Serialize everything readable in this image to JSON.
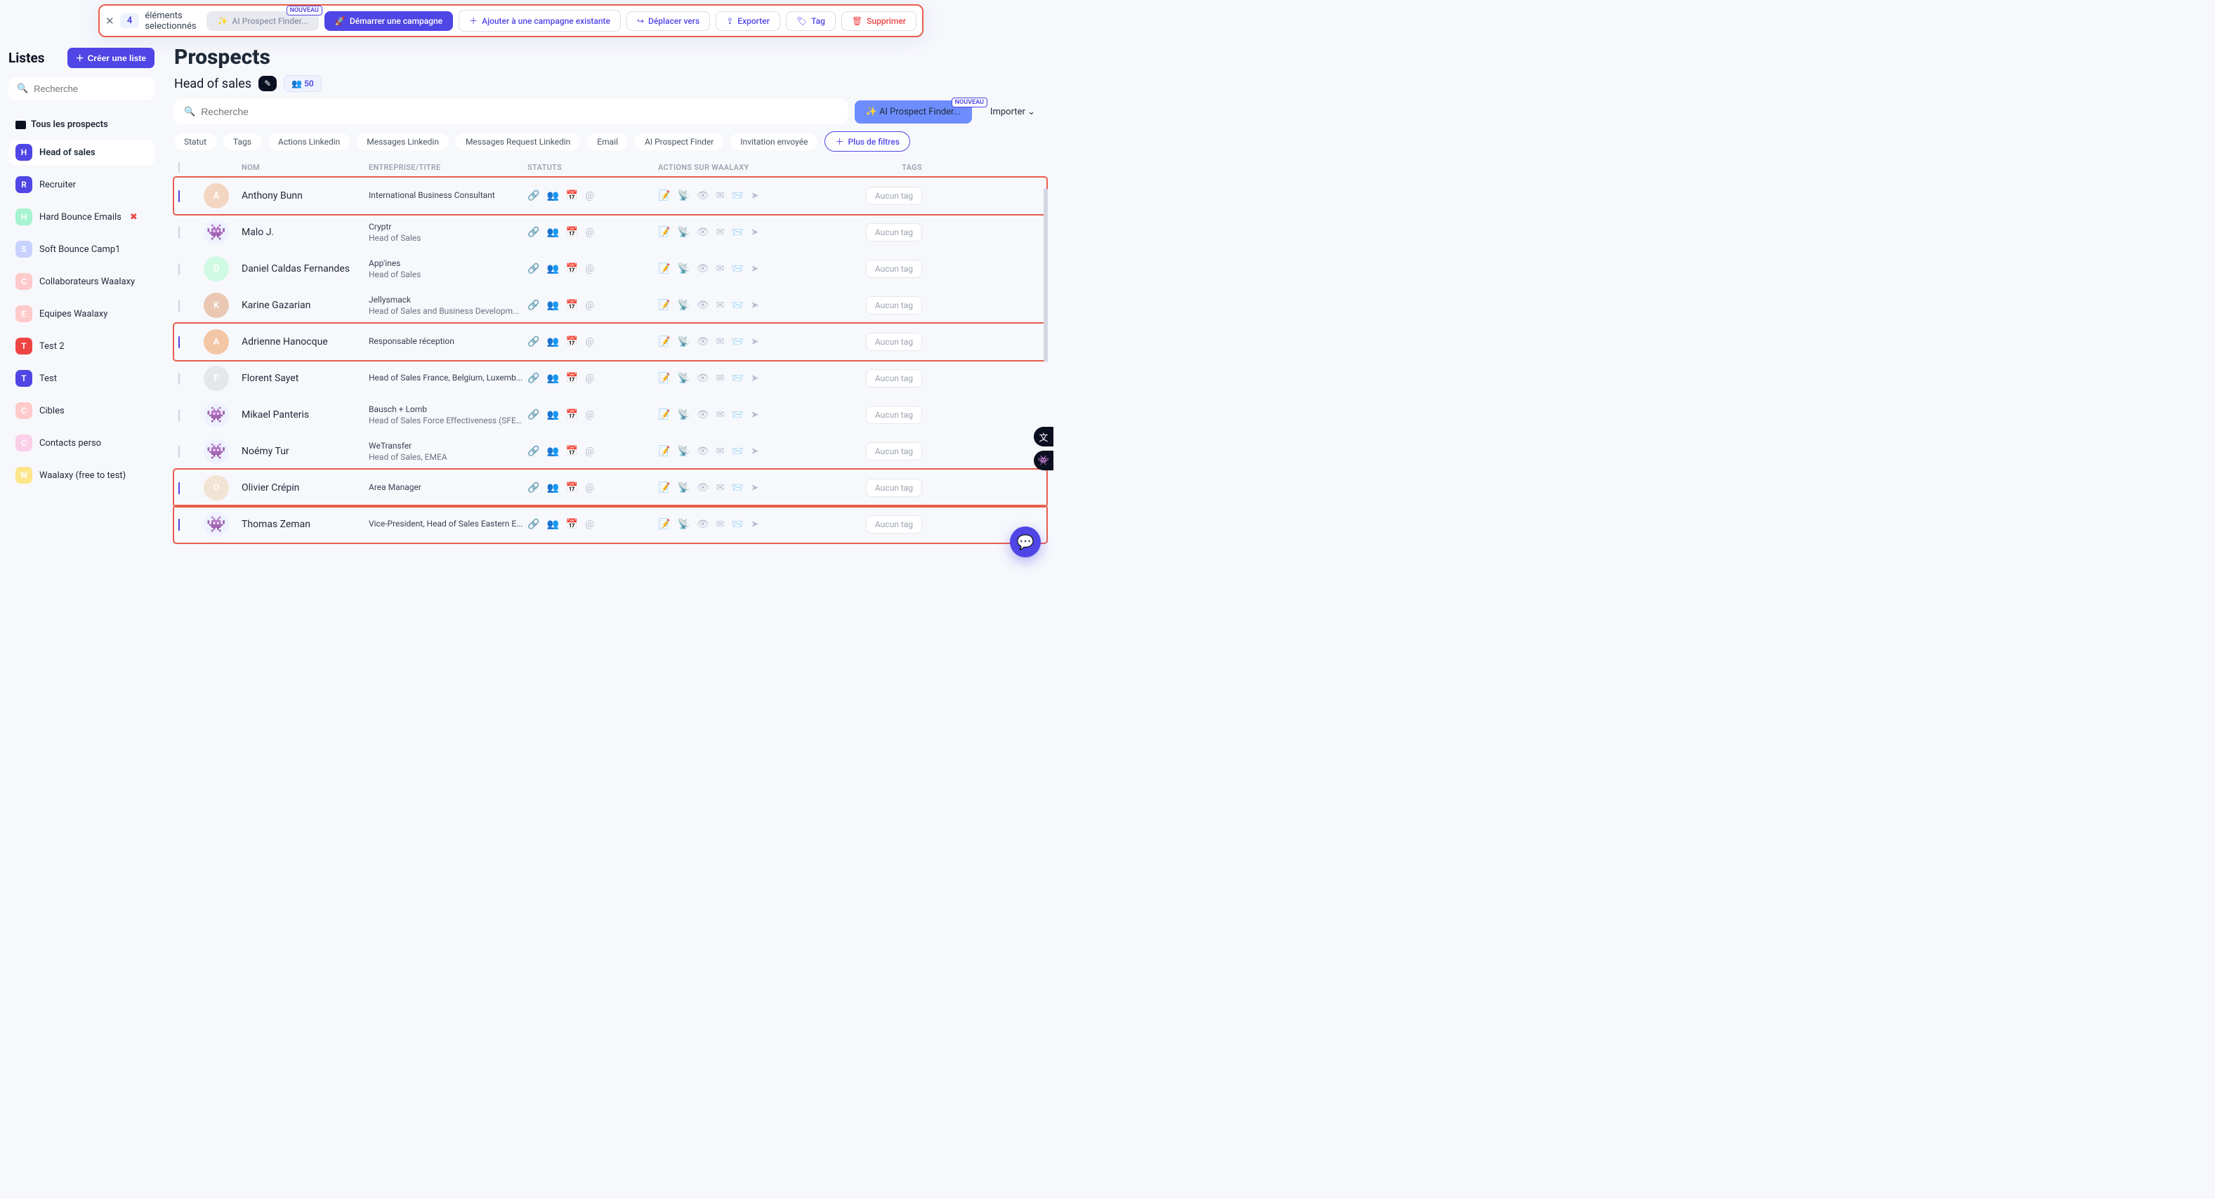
{
  "topbar": {
    "selected_count": "4",
    "selected_label": "éléments selectionnés",
    "ai_btn": "AI Prospect Finder...",
    "badge_new": "NOUVEAU",
    "start": "Démarrer une campagne",
    "add_existing": "Ajouter à une campagne existante",
    "move": "Déplacer vers",
    "export": "Exporter",
    "tag": "Tag",
    "delete": "Supprimer"
  },
  "sidebar": {
    "title": "Listes",
    "create": "Créer une liste",
    "search_ph": "Recherche",
    "all": "Tous les prospects",
    "lists": [
      {
        "letter": "H",
        "color": "#4f46e5",
        "label": "Head of sales",
        "active": true
      },
      {
        "letter": "R",
        "color": "#4f46e5",
        "label": "Recruiter"
      },
      {
        "letter": "H",
        "color": "#a7f3d0",
        "label": "Hard Bounce Emails",
        "x": true
      },
      {
        "letter": "S",
        "color": "#c7d2fe",
        "label": "Soft Bounce Camp1"
      },
      {
        "letter": "C",
        "color": "#fecaca",
        "label": "Collaborateurs Waalaxy"
      },
      {
        "letter": "E",
        "color": "#fecaca",
        "label": "Equipes Waalaxy"
      },
      {
        "letter": "T",
        "color": "#ef4444",
        "label": "Test 2"
      },
      {
        "letter": "T",
        "color": "#4f46e5",
        "label": "Test"
      },
      {
        "letter": "C",
        "color": "#fecaca",
        "label": "Cibles"
      },
      {
        "letter": "C",
        "color": "#fbcfe8",
        "label": "Contacts perso"
      },
      {
        "letter": "W",
        "color": "#fde68a",
        "label": "Waalaxy (free to test)"
      }
    ]
  },
  "main": {
    "title": "Prospects",
    "listname": "Head of sales",
    "count_badge": "50",
    "search_ph": "Recherche",
    "ai_finder": "AI Prospect Finder...",
    "import": "Importer",
    "filters": {
      "status": "Statut",
      "tags": "Tags",
      "la": "Actions Linkedin",
      "lm": "Messages Linkedin",
      "lrm": "Messages Request Linkedin",
      "email": "Email",
      "aip": "AI Prospect Finder",
      "inv": "Invitation envoyée",
      "more": "Plus de filtres"
    },
    "columns": {
      "name": "NOM",
      "company": "ENTREPRISE/TITRE",
      "status": "STATUTS",
      "actions": "ACTIONS SUR WAALAXY",
      "tags": "TAGS"
    },
    "tag_placeholder": "Aucun tag",
    "rows": [
      {
        "checked": true,
        "hl": 1,
        "avcolor": "#f3d6c2",
        "initial": "A",
        "name": "Anthony Bunn",
        "company": "",
        "title": "International Business Consultant"
      },
      {
        "checked": false,
        "avcolor": "#6366f1",
        "alien": 1,
        "name": "Malo J.",
        "company": "Cryptr",
        "title": "Head of Sales"
      },
      {
        "checked": false,
        "avcolor": "#d1fae5",
        "initial": "D",
        "name": "Daniel Caldas Fernandes",
        "company": "App'ines",
        "title": "Head of Sales"
      },
      {
        "checked": false,
        "avcolor": "#e9c7b2",
        "initial": "K",
        "name": "Karine Gazarian",
        "company": "Jellysmack",
        "title": "Head of Sales and Business Developm..."
      },
      {
        "checked": true,
        "hl": 1,
        "avcolor": "#f3c6a5",
        "initial": "A",
        "name": "Adrienne Hanocque",
        "company": "",
        "title": "Responsable réception"
      },
      {
        "checked": false,
        "avcolor": "#e5e7eb",
        "initial": "F",
        "name": "Florent Sayet",
        "company": "",
        "title": "Head of Sales France, Belgium, Luxemb..."
      },
      {
        "checked": false,
        "avcolor": "#6366f1",
        "alien": 1,
        "name": "Mikael Panteris",
        "company": "Bausch + Lomb",
        "title": "Head of Sales Force Effectiveness (SFE) ..."
      },
      {
        "checked": false,
        "avcolor": "#6366f1",
        "alien": 1,
        "name": "Noémy Tur",
        "company": "WeTransfer",
        "title": "Head of Sales, EMEA"
      },
      {
        "checked": true,
        "hl": 1,
        "avcolor": "#f1e4d4",
        "initial": "O",
        "name": "Olivier Crépin",
        "company": "",
        "title": "Area Manager"
      },
      {
        "checked": true,
        "hl": 1,
        "avcolor": "#6366f1",
        "alien": 1,
        "name": "Thomas Zeman",
        "company": "",
        "title": "Vice-President, Head of Sales Eastern E..."
      }
    ]
  }
}
